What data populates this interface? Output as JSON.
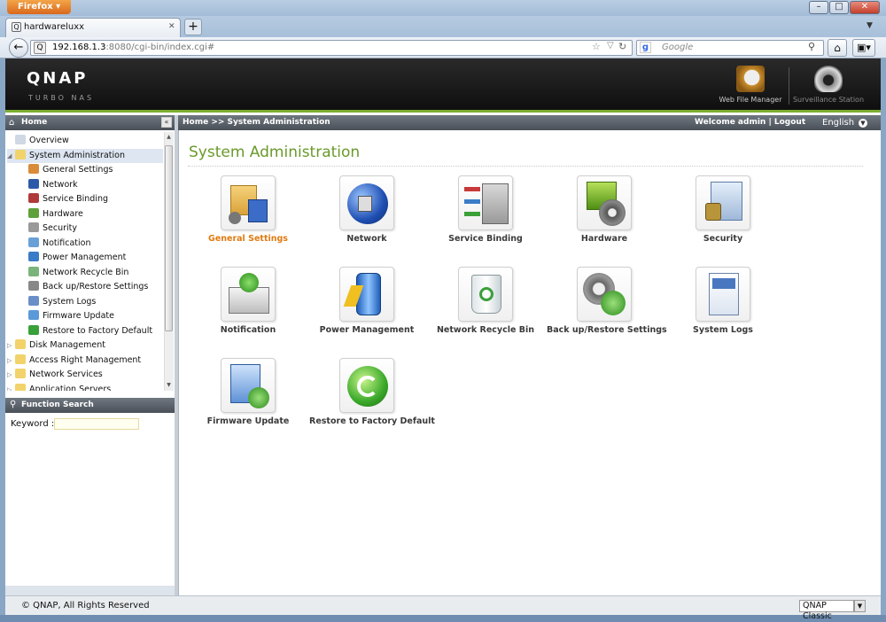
{
  "browser": {
    "menu_label": "Firefox",
    "tab_title": "hardwareluxx",
    "new_tab_label": "+",
    "url_host": "192.168.1.3",
    "url_path": ":8080/cgi-bin/index.cgi#",
    "search_engine": "Google"
  },
  "header": {
    "logo": "QNAP",
    "subtitle": "TURBO NAS",
    "apps": [
      {
        "label": "Web File Manager"
      },
      {
        "label": "Surveillance Station"
      }
    ]
  },
  "left_panel": {
    "title": "Home",
    "tree": [
      {
        "label": "Overview",
        "icon": "overview-icon"
      },
      {
        "label": "System Administration",
        "icon": "folder-open-icon",
        "selected": true
      },
      {
        "label": "General Settings",
        "icon": "general-settings-icon"
      },
      {
        "label": "Network",
        "icon": "network-icon"
      },
      {
        "label": "Service Binding",
        "icon": "service-binding-icon"
      },
      {
        "label": "Hardware",
        "icon": "hardware-icon"
      },
      {
        "label": "Security",
        "icon": "security-icon"
      },
      {
        "label": "Notification",
        "icon": "notification-icon"
      },
      {
        "label": "Power Management",
        "icon": "power-icon"
      },
      {
        "label": "Network Recycle Bin",
        "icon": "recycle-bin-icon"
      },
      {
        "label": "Back up/Restore Settings",
        "icon": "backup-icon"
      },
      {
        "label": "System Logs",
        "icon": "system-logs-icon"
      },
      {
        "label": "Firmware Update",
        "icon": "firmware-icon"
      },
      {
        "label": "Restore to Factory Default",
        "icon": "restore-icon"
      },
      {
        "label": "Disk Management",
        "icon": "folder-icon"
      },
      {
        "label": "Access Right Management",
        "icon": "folder-icon"
      },
      {
        "label": "Network Services",
        "icon": "folder-icon"
      },
      {
        "label": "Application Servers",
        "icon": "folder-icon"
      }
    ],
    "function_search_title": "Function Search",
    "keyword_label": "Keyword :",
    "keyword_value": ""
  },
  "main": {
    "breadcrumb": "Home >> System Administration",
    "welcome": "Welcome admin | Logout",
    "language": "English",
    "title": "System Administration",
    "tiles": [
      {
        "label": "General Settings",
        "icon": "general-settings-icon",
        "active": true
      },
      {
        "label": "Network",
        "icon": "network-icon"
      },
      {
        "label": "Service Binding",
        "icon": "service-binding-icon"
      },
      {
        "label": "Hardware",
        "icon": "hardware-icon"
      },
      {
        "label": "Security",
        "icon": "security-icon"
      },
      {
        "label": "Notification",
        "icon": "notification-icon"
      },
      {
        "label": "Power Management",
        "icon": "power-icon"
      },
      {
        "label": "Network Recycle Bin",
        "icon": "recycle-bin-icon"
      },
      {
        "label": "Back up/Restore Settings",
        "icon": "backup-icon"
      },
      {
        "label": "System Logs",
        "icon": "system-logs-icon"
      },
      {
        "label": "Firmware Update",
        "icon": "firmware-icon"
      },
      {
        "label": "Restore to Factory Default",
        "icon": "restore-icon"
      }
    ]
  },
  "footer": {
    "copyright": "© QNAP, All Rights Reserved",
    "theme": "QNAP Classic"
  }
}
